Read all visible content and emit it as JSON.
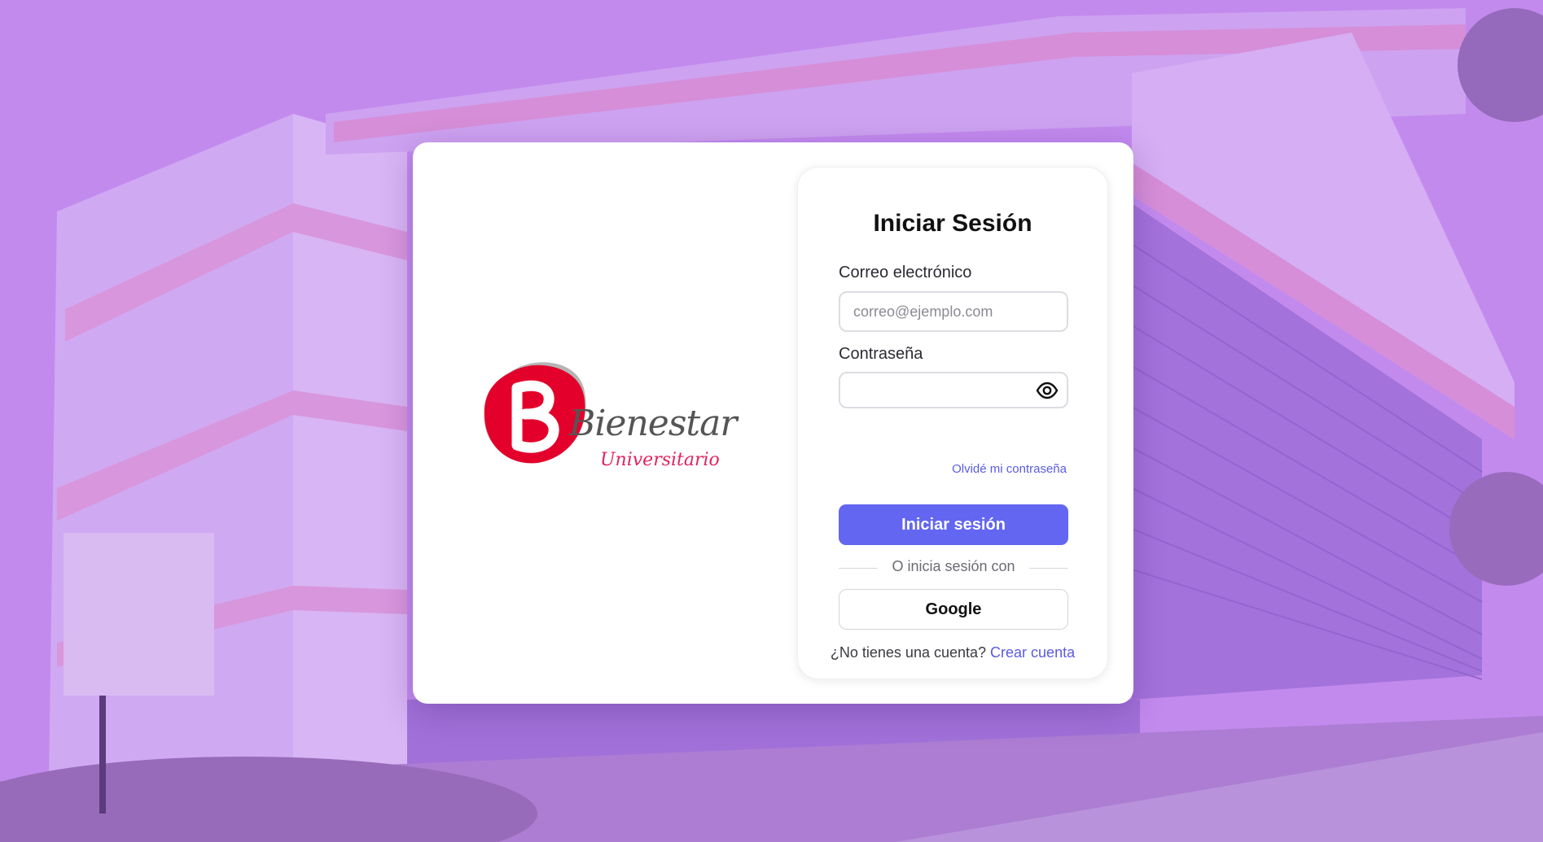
{
  "brand": {
    "logo_main": "Bienestar",
    "logo_sub": "Universitario"
  },
  "login": {
    "title": "Iniciar Sesión",
    "email_label": "Correo electrónico",
    "email_placeholder": "correo@ejemplo.com",
    "email_value": "",
    "password_label": "Contraseña",
    "password_value": "",
    "forgot_link": "Olvidé mi contraseña",
    "submit_label": "Iniciar sesión",
    "divider_text": "O inicia sesión con",
    "google_label": "Google",
    "signup_prompt": "¿No tienes una cuenta?",
    "signup_link": "Crear cuenta"
  },
  "colors": {
    "primary": "#6366f1",
    "link": "#5a5be0",
    "logo_red": "#e3002b",
    "logo_pink": "#e0245e",
    "background_tint": "#b27ee4"
  },
  "icons": {
    "password_toggle": "eye-icon"
  }
}
